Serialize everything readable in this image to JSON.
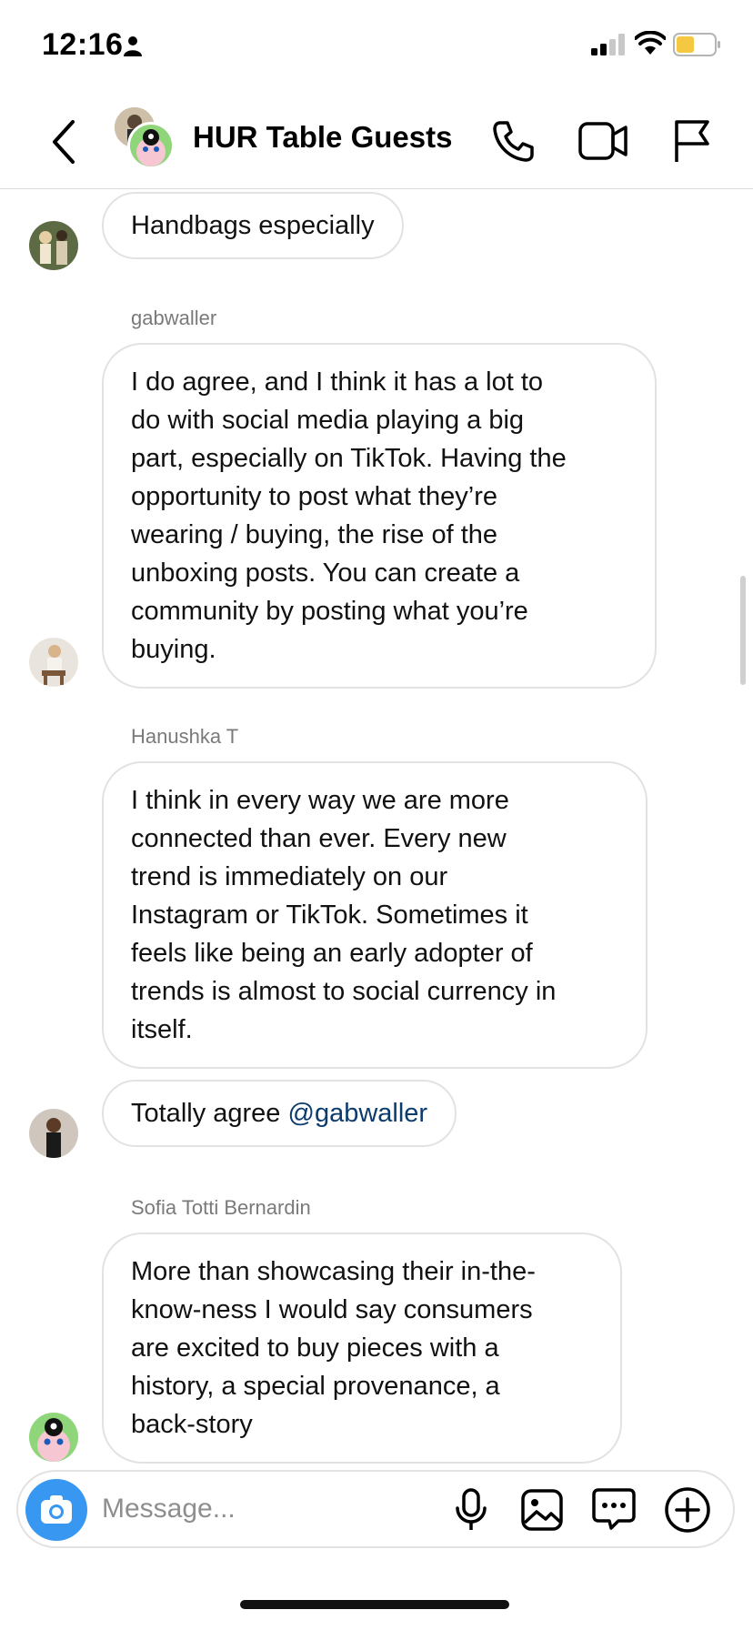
{
  "status_bar": {
    "time": "12:16",
    "battery_color": "#f5c842"
  },
  "header": {
    "title": "HUR Table Guests"
  },
  "messages": [
    {
      "sender": "",
      "text": "Handbags especially"
    },
    {
      "sender": "gabwaller",
      "lines": [
        "I do agree, and I think it has a lot to",
        "do with social media playing a big",
        "part, especially on TikTok. Having the",
        "opportunity to post what they’re",
        "wearing / buying, the rise of the",
        "unboxing posts. You can create a",
        "community by posting what you’re",
        "buying."
      ]
    },
    {
      "sender": "Hanushka T",
      "lines": [
        "I think in every way we are more",
        "connected than ever. Every new",
        "trend is immediately on our",
        "Instagram or TikTok. Sometimes it",
        "feels like being an early adopter of",
        "trends is almost to social currency in",
        "itself."
      ]
    },
    {
      "sender": "",
      "text_prefix": "Totally agree ",
      "mention": "@gabwaller"
    },
    {
      "sender": "Sofia Totti Bernardin",
      "lines": [
        "More than showcasing their in-the-",
        "know-ness I would say consumers",
        "are excited to buy pieces with a",
        "history, a special provenance, a",
        "back-story"
      ]
    }
  ],
  "composer": {
    "placeholder": "Message..."
  },
  "colors": {
    "accent": "#3897f0",
    "mention": "#0c3b6e",
    "bubble_border": "#e2e2e2"
  }
}
